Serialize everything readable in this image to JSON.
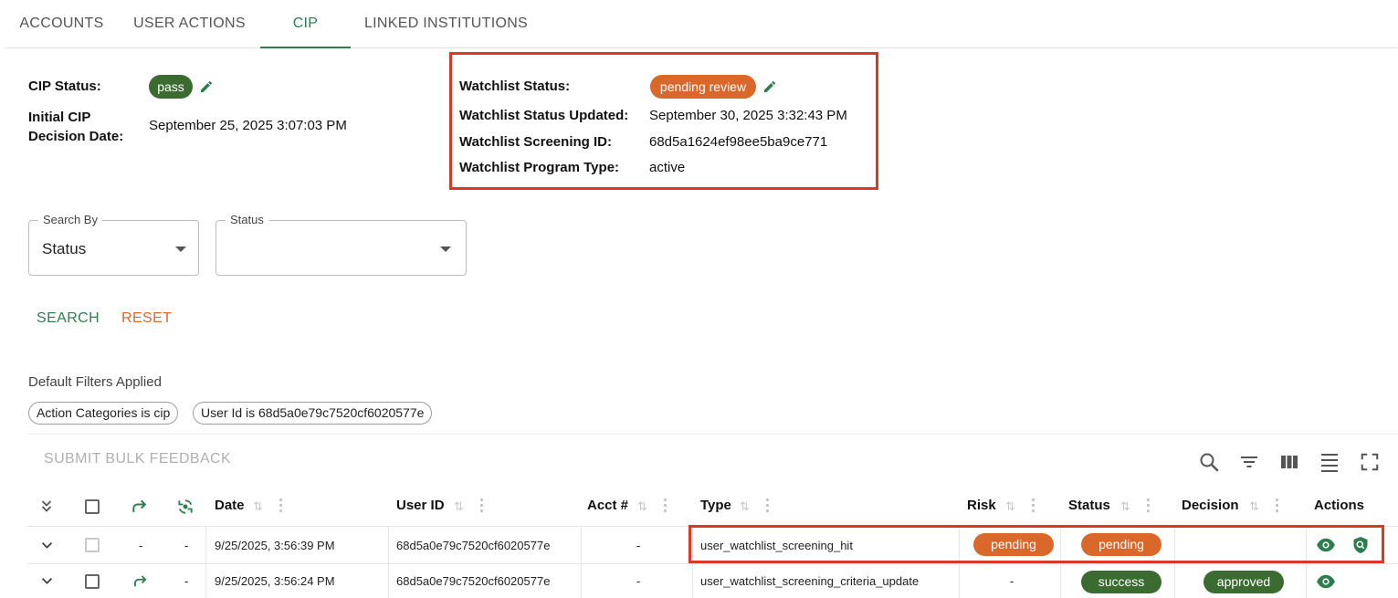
{
  "tabs": [
    {
      "label": "ACCOUNTS"
    },
    {
      "label": "USER ACTIONS"
    },
    {
      "label": "CIP"
    },
    {
      "label": "LINKED INSTITUTIONS"
    }
  ],
  "cip": {
    "status_label": "CIP Status:",
    "status_value": "pass",
    "initial_label_line1": "Initial CIP",
    "initial_label_line2": "Decision Date:",
    "initial_value": "September 25, 2025 3:07:03 PM"
  },
  "watchlist": {
    "status_label": "Watchlist Status:",
    "status_value": "pending review",
    "updated_label": "Watchlist Status Updated:",
    "updated_value": "September 30, 2025 3:32:43 PM",
    "screening_label": "Watchlist Screening ID:",
    "screening_value": "68d5a1624ef98ee5ba9ce771",
    "program_label": "Watchlist Program Type:",
    "program_value": "active"
  },
  "search": {
    "search_by_label": "Search By",
    "search_by_value": "Status",
    "status_label": "Status",
    "status_value": "",
    "search_button": "SEARCH",
    "reset_button": "RESET"
  },
  "filters": {
    "heading": "Default Filters Applied",
    "chips": [
      "Action Categories is cip",
      "User Id is 68d5a0e79c7520cf6020577e"
    ]
  },
  "table": {
    "bulk_button": "SUBMIT BULK FEEDBACK",
    "columns": {
      "date": "Date",
      "user_id": "User ID",
      "acct": "Acct #",
      "type": "Type",
      "risk": "Risk",
      "status": "Status",
      "decision": "Decision",
      "actions": "Actions"
    },
    "rows": [
      {
        "col3": "-",
        "col4": "-",
        "date": "9/25/2025, 3:56:39 PM",
        "user_id": "68d5a0e79c7520cf6020577e",
        "acct": "-",
        "type": "user_watchlist_screening_hit",
        "risk": "pending",
        "status": "pending",
        "decision": ""
      },
      {
        "col3": "",
        "col4": "-",
        "date": "9/25/2025, 3:56:24 PM",
        "user_id": "68d5a0e79c7520cf6020577e",
        "acct": "-",
        "type": "user_watchlist_screening_criteria_update",
        "risk": "-",
        "status": "success",
        "decision": "approved"
      }
    ]
  },
  "colors": {
    "accent_green": "#2e7d4f",
    "pill_green": "#3b6b30",
    "pill_orange": "#d9682a",
    "reset_orange": "#d9682a",
    "highlight_red": "#d93a26"
  }
}
